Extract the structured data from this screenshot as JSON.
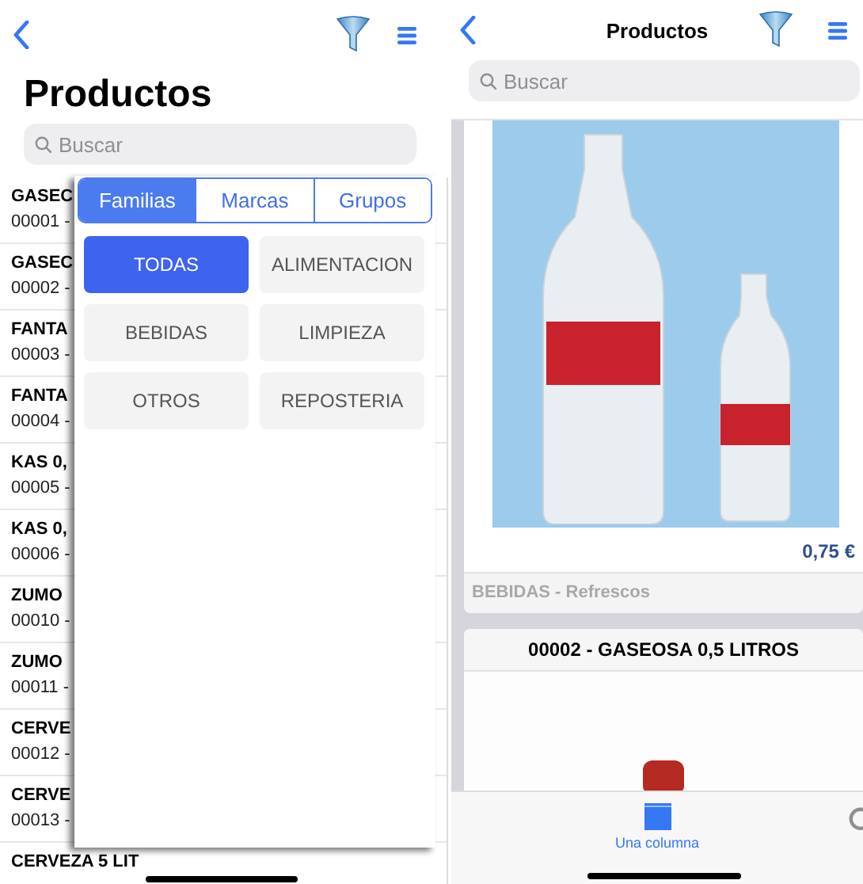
{
  "left_screen": {
    "title": "Productos",
    "search": {
      "placeholder": "Buscar"
    },
    "rows": [
      {
        "name": "GASEC",
        "code": "00001 -"
      },
      {
        "name": "GASEC",
        "code": "00002 -"
      },
      {
        "name": "FANTA",
        "code": "00003 -"
      },
      {
        "name": "FANTA",
        "code": "00004 -"
      },
      {
        "name": "KAS 0,",
        "code": "00005 -"
      },
      {
        "name": "KAS 0,",
        "code": "00006 -"
      },
      {
        "name": "ZUMO",
        "code": "00010 -"
      },
      {
        "name": "ZUMO",
        "code": "00011 -"
      },
      {
        "name": "CERVE",
        "code": "00012 -"
      },
      {
        "name": "CERVE",
        "code": "00013 -"
      },
      {
        "name": "CERVEZA 5 LIT"
      }
    ],
    "popover": {
      "tabs": [
        {
          "label": "Familias",
          "selected": true
        },
        {
          "label": "Marcas",
          "selected": false
        },
        {
          "label": "Grupos",
          "selected": false
        }
      ],
      "categories": [
        {
          "label": "TODAS",
          "selected": true
        },
        {
          "label": "ALIMENTACION",
          "selected": false
        },
        {
          "label": "BEBIDAS",
          "selected": false
        },
        {
          "label": "LIMPIEZA",
          "selected": false
        },
        {
          "label": "OTROS",
          "selected": false
        },
        {
          "label": "REPOSTERIA",
          "selected": false
        }
      ]
    }
  },
  "right_screen": {
    "title": "Productos",
    "search": {
      "placeholder": "Buscar"
    },
    "cards": [
      {
        "kind": "photo",
        "price": "0,75 €",
        "category": "BEBIDAS - Refrescos"
      },
      {
        "kind": "photo",
        "title": "00002 - GASEOSA 0,5 LITROS"
      }
    ],
    "tab_bar": [
      {
        "label": "Una columna",
        "selected": true
      }
    ]
  }
}
